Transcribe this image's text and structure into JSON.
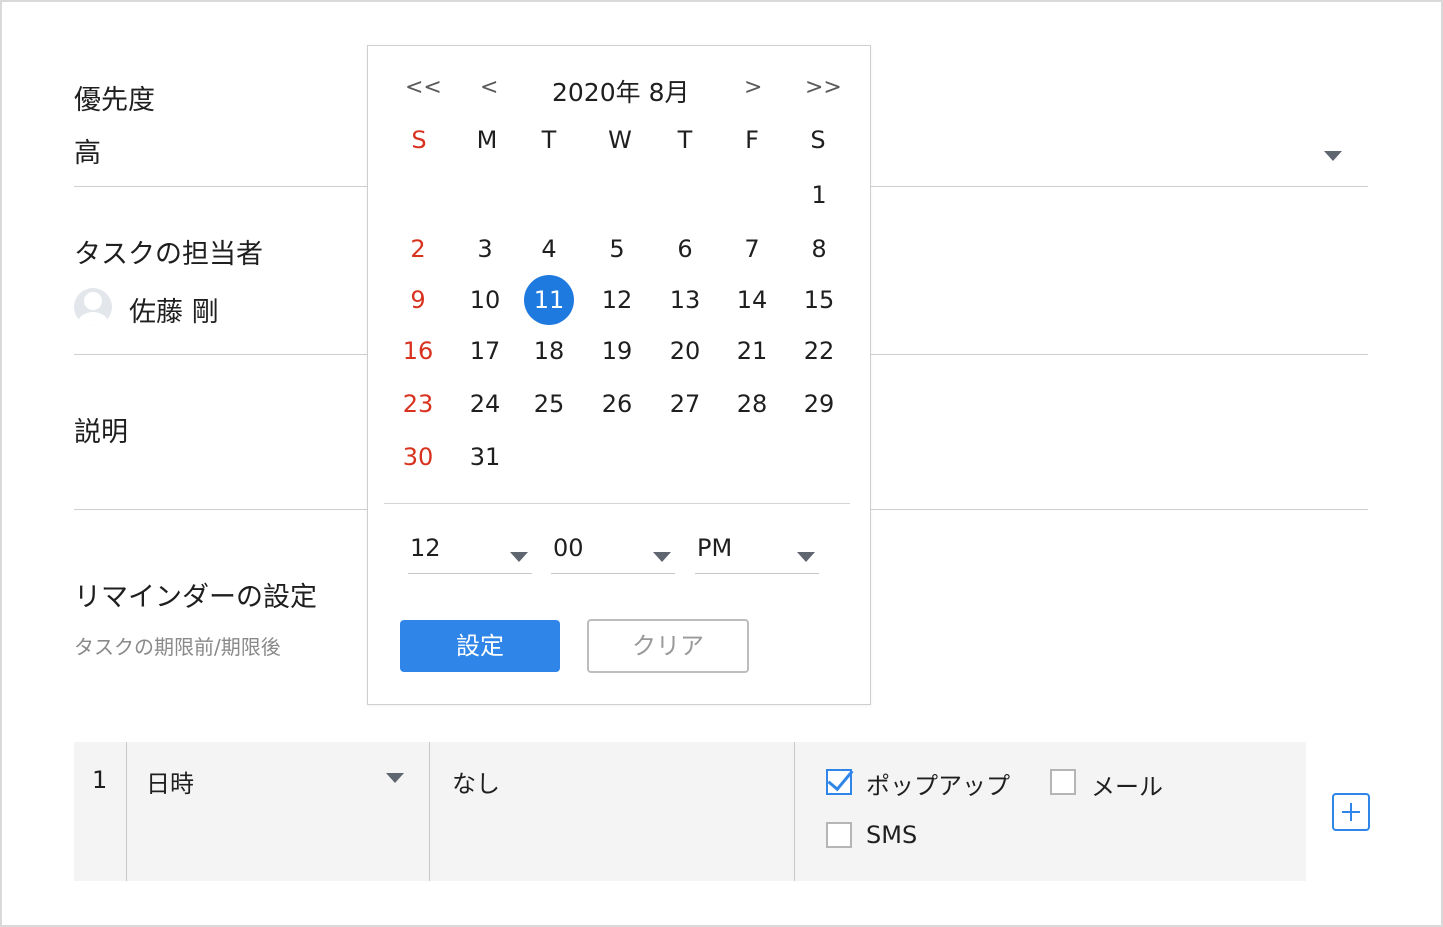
{
  "form": {
    "priority": {
      "label": "優先度",
      "value": "高"
    },
    "assignee": {
      "label": "タスクの担当者",
      "name": "佐藤 剛"
    },
    "description": {
      "label": "説明"
    },
    "reminder": {
      "label": "リマインダーの設定",
      "sublabel": "タスクの期限前/期限後"
    }
  },
  "reminder_row": {
    "index": "1",
    "type": "日時",
    "value": "なし",
    "options": [
      {
        "label": "ポップアップ",
        "checked": true
      },
      {
        "label": "メール",
        "checked": false
      },
      {
        "label": "SMS",
        "checked": false
      }
    ]
  },
  "date_picker": {
    "prev_year": "<<",
    "prev_month": "<",
    "title": "2020年 8月",
    "next_month": ">",
    "next_year": ">>",
    "weekdays": [
      "S",
      "M",
      "T",
      "W",
      "T",
      "F",
      "S"
    ],
    "selected_day": "11",
    "hour": "12",
    "minute": "00",
    "ampm": "PM",
    "set_label": "設定",
    "clear_label": "クリア",
    "colors": {
      "accent": "#1f7ae0",
      "sunday": "#d8321f",
      "button": "#2f86e8"
    }
  }
}
